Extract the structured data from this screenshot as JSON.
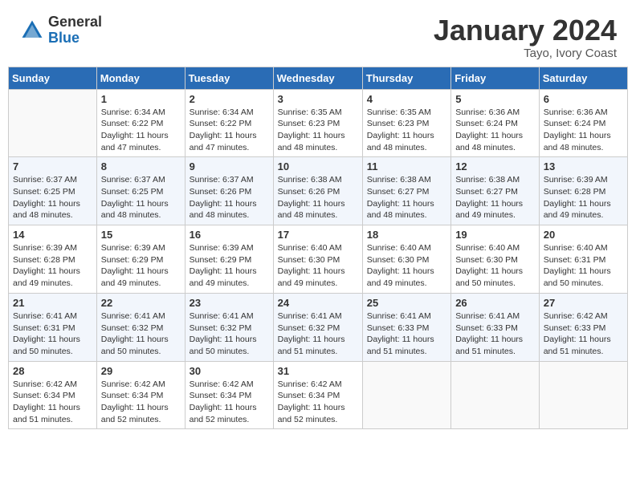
{
  "header": {
    "logo_general": "General",
    "logo_blue": "Blue",
    "month_title": "January 2024",
    "location": "Tayo, Ivory Coast"
  },
  "weekdays": [
    "Sunday",
    "Monday",
    "Tuesday",
    "Wednesday",
    "Thursday",
    "Friday",
    "Saturday"
  ],
  "weeks": [
    [
      {
        "day": "",
        "info": ""
      },
      {
        "day": "1",
        "info": "Sunrise: 6:34 AM\nSunset: 6:22 PM\nDaylight: 11 hours\nand 47 minutes."
      },
      {
        "day": "2",
        "info": "Sunrise: 6:34 AM\nSunset: 6:22 PM\nDaylight: 11 hours\nand 47 minutes."
      },
      {
        "day": "3",
        "info": "Sunrise: 6:35 AM\nSunset: 6:23 PM\nDaylight: 11 hours\nand 48 minutes."
      },
      {
        "day": "4",
        "info": "Sunrise: 6:35 AM\nSunset: 6:23 PM\nDaylight: 11 hours\nand 48 minutes."
      },
      {
        "day": "5",
        "info": "Sunrise: 6:36 AM\nSunset: 6:24 PM\nDaylight: 11 hours\nand 48 minutes."
      },
      {
        "day": "6",
        "info": "Sunrise: 6:36 AM\nSunset: 6:24 PM\nDaylight: 11 hours\nand 48 minutes."
      }
    ],
    [
      {
        "day": "7",
        "info": "Sunrise: 6:37 AM\nSunset: 6:25 PM\nDaylight: 11 hours\nand 48 minutes."
      },
      {
        "day": "8",
        "info": "Sunrise: 6:37 AM\nSunset: 6:25 PM\nDaylight: 11 hours\nand 48 minutes."
      },
      {
        "day": "9",
        "info": "Sunrise: 6:37 AM\nSunset: 6:26 PM\nDaylight: 11 hours\nand 48 minutes."
      },
      {
        "day": "10",
        "info": "Sunrise: 6:38 AM\nSunset: 6:26 PM\nDaylight: 11 hours\nand 48 minutes."
      },
      {
        "day": "11",
        "info": "Sunrise: 6:38 AM\nSunset: 6:27 PM\nDaylight: 11 hours\nand 48 minutes."
      },
      {
        "day": "12",
        "info": "Sunrise: 6:38 AM\nSunset: 6:27 PM\nDaylight: 11 hours\nand 49 minutes."
      },
      {
        "day": "13",
        "info": "Sunrise: 6:39 AM\nSunset: 6:28 PM\nDaylight: 11 hours\nand 49 minutes."
      }
    ],
    [
      {
        "day": "14",
        "info": "Sunrise: 6:39 AM\nSunset: 6:28 PM\nDaylight: 11 hours\nand 49 minutes."
      },
      {
        "day": "15",
        "info": "Sunrise: 6:39 AM\nSunset: 6:29 PM\nDaylight: 11 hours\nand 49 minutes."
      },
      {
        "day": "16",
        "info": "Sunrise: 6:39 AM\nSunset: 6:29 PM\nDaylight: 11 hours\nand 49 minutes."
      },
      {
        "day": "17",
        "info": "Sunrise: 6:40 AM\nSunset: 6:30 PM\nDaylight: 11 hours\nand 49 minutes."
      },
      {
        "day": "18",
        "info": "Sunrise: 6:40 AM\nSunset: 6:30 PM\nDaylight: 11 hours\nand 49 minutes."
      },
      {
        "day": "19",
        "info": "Sunrise: 6:40 AM\nSunset: 6:30 PM\nDaylight: 11 hours\nand 50 minutes."
      },
      {
        "day": "20",
        "info": "Sunrise: 6:40 AM\nSunset: 6:31 PM\nDaylight: 11 hours\nand 50 minutes."
      }
    ],
    [
      {
        "day": "21",
        "info": "Sunrise: 6:41 AM\nSunset: 6:31 PM\nDaylight: 11 hours\nand 50 minutes."
      },
      {
        "day": "22",
        "info": "Sunrise: 6:41 AM\nSunset: 6:32 PM\nDaylight: 11 hours\nand 50 minutes."
      },
      {
        "day": "23",
        "info": "Sunrise: 6:41 AM\nSunset: 6:32 PM\nDaylight: 11 hours\nand 50 minutes."
      },
      {
        "day": "24",
        "info": "Sunrise: 6:41 AM\nSunset: 6:32 PM\nDaylight: 11 hours\nand 51 minutes."
      },
      {
        "day": "25",
        "info": "Sunrise: 6:41 AM\nSunset: 6:33 PM\nDaylight: 11 hours\nand 51 minutes."
      },
      {
        "day": "26",
        "info": "Sunrise: 6:41 AM\nSunset: 6:33 PM\nDaylight: 11 hours\nand 51 minutes."
      },
      {
        "day": "27",
        "info": "Sunrise: 6:42 AM\nSunset: 6:33 PM\nDaylight: 11 hours\nand 51 minutes."
      }
    ],
    [
      {
        "day": "28",
        "info": "Sunrise: 6:42 AM\nSunset: 6:34 PM\nDaylight: 11 hours\nand 51 minutes."
      },
      {
        "day": "29",
        "info": "Sunrise: 6:42 AM\nSunset: 6:34 PM\nDaylight: 11 hours\nand 52 minutes."
      },
      {
        "day": "30",
        "info": "Sunrise: 6:42 AM\nSunset: 6:34 PM\nDaylight: 11 hours\nand 52 minutes."
      },
      {
        "day": "31",
        "info": "Sunrise: 6:42 AM\nSunset: 6:34 PM\nDaylight: 11 hours\nand 52 minutes."
      },
      {
        "day": "",
        "info": ""
      },
      {
        "day": "",
        "info": ""
      },
      {
        "day": "",
        "info": ""
      }
    ]
  ]
}
